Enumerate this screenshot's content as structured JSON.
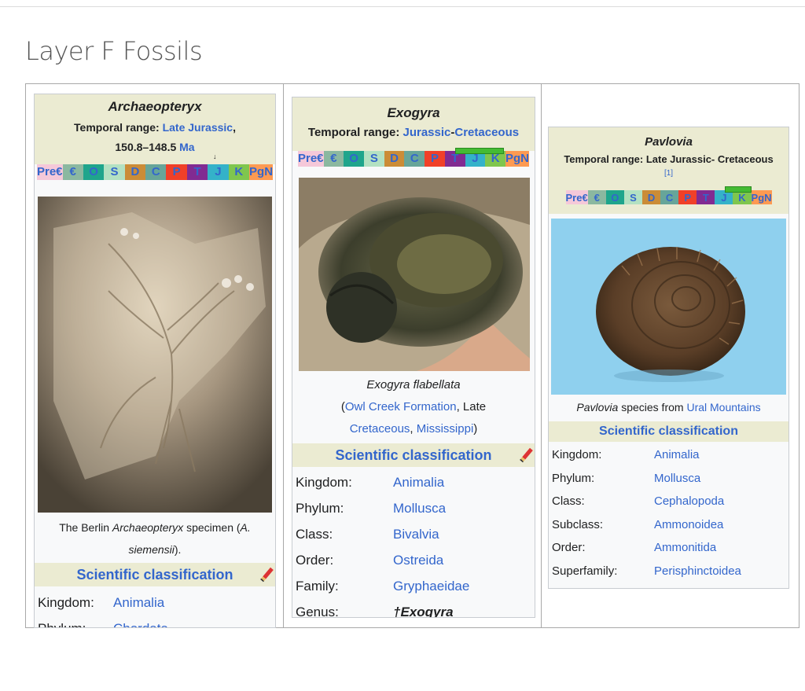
{
  "page": {
    "title": "Layer F Fossils"
  },
  "periods": [
    "Pre€",
    "€",
    "O",
    "S",
    "D",
    "C",
    "P",
    "T",
    "J",
    "K",
    "PgN"
  ],
  "period_colors": [
    "#f5c8d9",
    "#8bb8a0",
    "#1fa58c",
    "#b3e1c2",
    "#cb8c37",
    "#67a599",
    "#f04028",
    "#812b92",
    "#34b2c9",
    "#7fc64e",
    "#fd9a52"
  ],
  "cards": [
    {
      "name": "Archaeopteryx",
      "temporal_label": "Temporal range:",
      "range_link": "Late Jurassic",
      "range_comma": ",",
      "range_value": "150.8–148.5",
      "range_unit": "Ma",
      "caption_pre": "The Berlin ",
      "caption_italic": "Archaeopteryx",
      "caption_mid": " specimen (",
      "caption_italic2": "A. siemensii",
      "caption_post": ").",
      "sc_title": "Scientific classification",
      "taxonomy": [
        {
          "rank": "Kingdom:",
          "value": "Animalia"
        },
        {
          "rank": "Phylum:",
          "value": "Chordata"
        }
      ]
    },
    {
      "name": "Exogyra",
      "temporal_label": "Temporal range:",
      "range_a": "Jurassic",
      "range_dash": "-",
      "range_b": "Cretaceous",
      "caption_italic": "Exogyra flabellata",
      "caption_open": "(",
      "caption_link1": "Owl Creek Formation",
      "caption_mid": ", Late",
      "caption_link2": "Cretaceous",
      "caption_comma": ", ",
      "caption_link3": "Mississippi",
      "caption_close": ")",
      "sc_title": "Scientific classification",
      "taxonomy": [
        {
          "rank": "Kingdom:",
          "value": "Animalia"
        },
        {
          "rank": "Phylum:",
          "value": "Mollusca"
        },
        {
          "rank": "Class:",
          "value": "Bivalvia"
        },
        {
          "rank": "Order:",
          "value": "Ostreida"
        },
        {
          "rank": "Family:",
          "value": "Gryphaeidae"
        }
      ],
      "genus_rank": "Genus:",
      "genus_value": "†Exogyra"
    },
    {
      "name": "Pavlovia",
      "temporal_label": "Temporal range:",
      "range_text": "Late Jurassic- Cretaceous",
      "ref": "[1]",
      "caption_italic": "Pavlovia",
      "caption_mid": " species from ",
      "caption_link": "Ural Mountains",
      "sc_title": "Scientific classification",
      "taxonomy": [
        {
          "rank": "Kingdom:",
          "value": "Animalia"
        },
        {
          "rank": "Phylum:",
          "value": "Mollusca"
        },
        {
          "rank": "Class:",
          "value": "Cephalopoda"
        },
        {
          "rank": "Subclass:",
          "value": "Ammonoidea"
        },
        {
          "rank": "Order:",
          "value": "Ammonitida"
        },
        {
          "rank": "Superfamily:",
          "value": "Perisphinctoidea"
        }
      ]
    }
  ]
}
